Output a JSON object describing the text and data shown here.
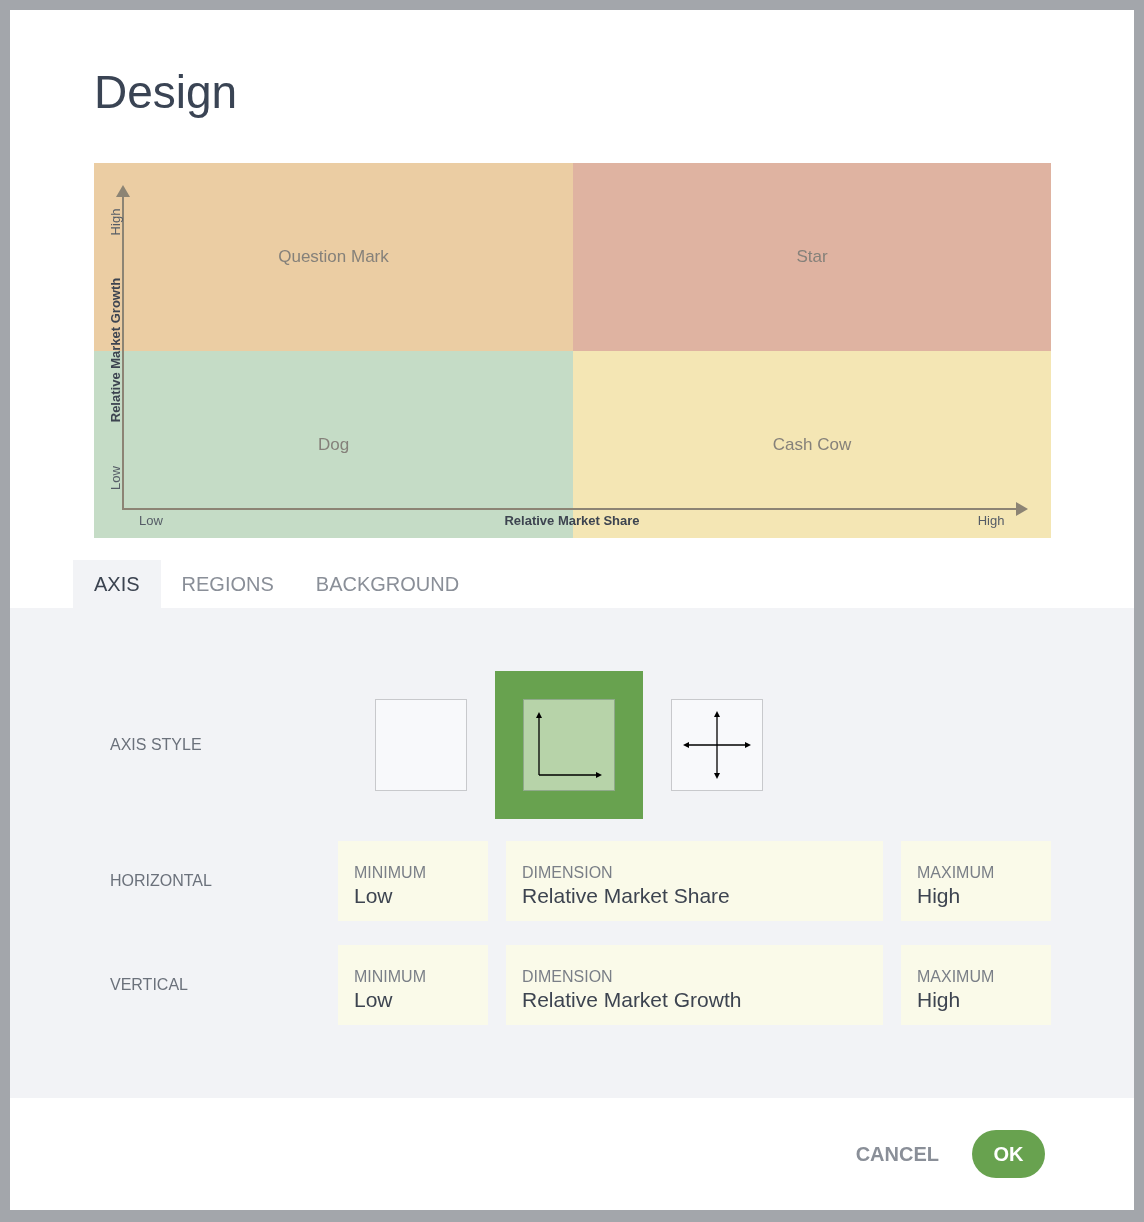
{
  "dialog": {
    "title": "Design"
  },
  "matrix": {
    "quadrants": [
      {
        "label": "Question Mark",
        "color": "#ebcda3"
      },
      {
        "label": "Star",
        "color": "#dfb3a1"
      },
      {
        "label": "Dog",
        "color": "#c5dcc6"
      },
      {
        "label": "Cash Cow",
        "color": "#f4e6b4"
      }
    ],
    "y_axis": {
      "title": "Relative Market Growth",
      "min": "Low",
      "max": "High"
    },
    "x_axis": {
      "title": "Relative Market Share",
      "min": "Low",
      "max": "High"
    }
  },
  "tabs": [
    {
      "label": "AXIS",
      "selected": true
    },
    {
      "label": "REGIONS",
      "selected": false
    },
    {
      "label": "BACKGROUND",
      "selected": false
    }
  ],
  "axis_style": {
    "label": "AXIS STYLE",
    "options": [
      {
        "kind": "none",
        "selected": false
      },
      {
        "kind": "corner",
        "selected": true
      },
      {
        "kind": "cross",
        "selected": false
      }
    ]
  },
  "rows": [
    {
      "label": "HORIZONTAL",
      "fields": [
        {
          "label": "MINIMUM",
          "value": "Low"
        },
        {
          "label": "DIMENSION",
          "value": "Relative Market Share"
        },
        {
          "label": "MAXIMUM",
          "value": "High"
        }
      ]
    },
    {
      "label": "VERTICAL",
      "fields": [
        {
          "label": "MINIMUM",
          "value": "Low"
        },
        {
          "label": "DIMENSION",
          "value": "Relative Market Growth"
        },
        {
          "label": "MAXIMUM",
          "value": "High"
        }
      ]
    }
  ],
  "buttons": {
    "cancel": "CANCEL",
    "ok": "OK"
  }
}
